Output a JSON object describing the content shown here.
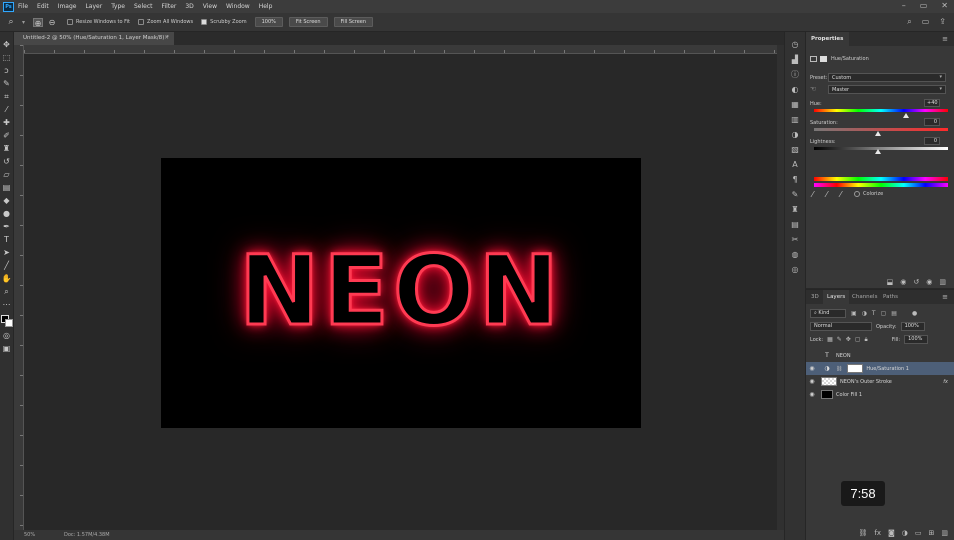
{
  "menubar": {
    "logo": "Ps",
    "items": [
      "File",
      "Edit",
      "Image",
      "Layer",
      "Type",
      "Select",
      "Filter",
      "3D",
      "View",
      "Window",
      "Help"
    ]
  },
  "options": {
    "resize_windows": "Resize Windows to Fit",
    "zoom_all": "Zoom All Windows",
    "scrubby_zoom": "Scrubby Zoom",
    "zoom_value": "100%",
    "fit_screen": "Fit Screen",
    "fill_screen": "Fill Screen"
  },
  "document": {
    "tab_title": "Untitled-2 @ 50% (Hue/Saturation 1, Layer Mask/8) *",
    "neon_text": "NEON",
    "zoom": "50%",
    "doc_size": "Doc: 1.57M/4.38M"
  },
  "properties": {
    "tab": "Properties",
    "adjustment_name": "Hue/Saturation",
    "preset_label": "Preset:",
    "preset_value": "Custom",
    "channel_value": "Master",
    "hue_label": "Hue:",
    "hue_value": "+40",
    "saturation_label": "Saturation:",
    "saturation_value": "0",
    "lightness_label": "Lightness:",
    "lightness_value": "0",
    "colorize_label": "Colorize"
  },
  "layers_panel": {
    "tabs": [
      "3D",
      "Layers",
      "Channels",
      "Paths"
    ],
    "kind_label": "Kind",
    "blend_mode": "Normal",
    "opacity_label": "Opacity:",
    "opacity_value": "100%",
    "lock_label": "Lock:",
    "fill_label": "Fill:",
    "fill_value": "100%",
    "layers": [
      {
        "name": "NEON",
        "visible": false,
        "thumb": "type"
      },
      {
        "name": "Hue/Saturation 1",
        "visible": true,
        "thumb": "adjustment",
        "selected": true
      },
      {
        "name": "NEON's Outer Stroke",
        "visible": true,
        "thumb": "checker",
        "fx": "fx"
      },
      {
        "name": "Color Fill 1",
        "visible": true,
        "thumb": "black"
      }
    ]
  },
  "video": {
    "timestamp": "7:58"
  },
  "colors": {
    "neon": "#ff3a52",
    "selected_layer": "#4d5f78",
    "ps_blue": "#31a8ff"
  }
}
